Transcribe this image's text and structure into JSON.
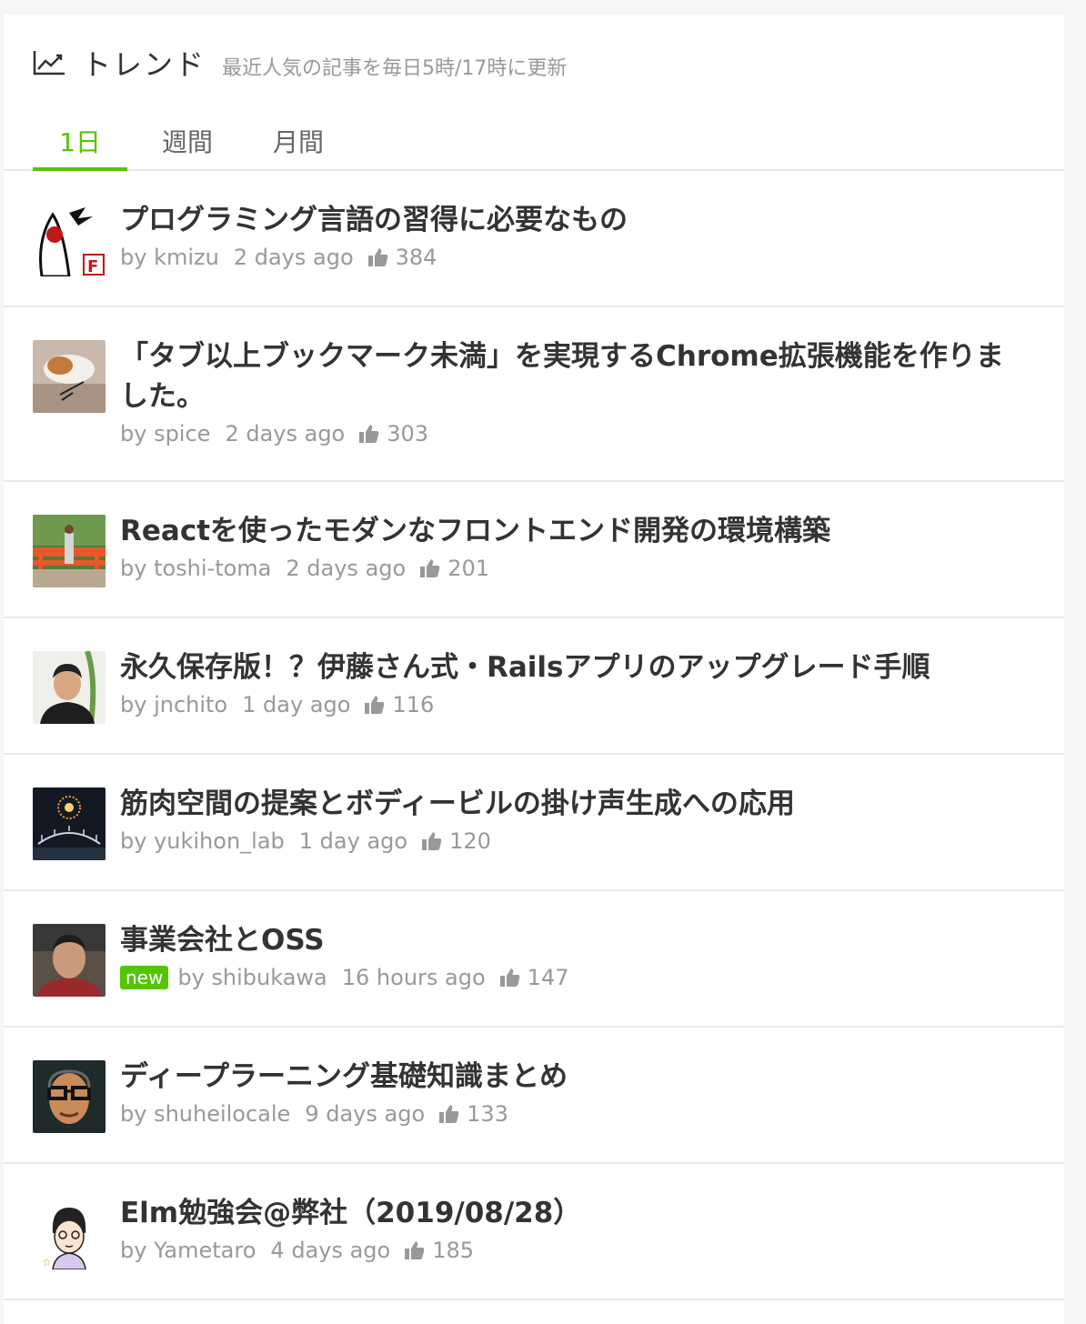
{
  "header": {
    "icon": "trending-up-icon",
    "title": "トレンド",
    "description": "最近人気の記事を毎日5時/17時に更新"
  },
  "tabs": [
    {
      "label": "1日",
      "active": true
    },
    {
      "label": "週間",
      "active": false
    },
    {
      "label": "月間",
      "active": false
    }
  ],
  "colors": {
    "accent": "#55c500",
    "muted": "#999999",
    "text": "#333333"
  },
  "articles": [
    {
      "title": "プログラミング言語の習得に必要なもの",
      "author": "by kmizu",
      "time": "2 days ago",
      "likes": "384",
      "new": ""
    },
    {
      "title": "「タブ以上ブックマーク未満」を実現するChrome拡張機能を作りました。",
      "author": "by spice",
      "time": "2 days ago",
      "likes": "303",
      "new": ""
    },
    {
      "title": "Reactを使ったモダンなフロントエンド開発の環境構築",
      "author": "by toshi-toma",
      "time": "2 days ago",
      "likes": "201",
      "new": ""
    },
    {
      "title": "永久保存版！？伊藤さん式・Railsアプリのアップグレード手順",
      "author": "by jnchito",
      "time": "1 day ago",
      "likes": "116",
      "new": ""
    },
    {
      "title": "筋肉空間の提案とボディービルの掛け声生成への応用",
      "author": "by yukihon_lab",
      "time": "1 day ago",
      "likes": "120",
      "new": ""
    },
    {
      "title": "事業会社とOSS",
      "author": "by shibukawa",
      "time": "16 hours ago",
      "likes": "147",
      "new": "new"
    },
    {
      "title": "ディープラーニング基礎知識まとめ",
      "author": "by shuheilocale",
      "time": "9 days ago",
      "likes": "133",
      "new": ""
    },
    {
      "title": "Elm勉強会@弊社（2019/08/28）",
      "author": "by Yametaro",
      "time": "4 days ago",
      "likes": "185",
      "new": ""
    }
  ]
}
